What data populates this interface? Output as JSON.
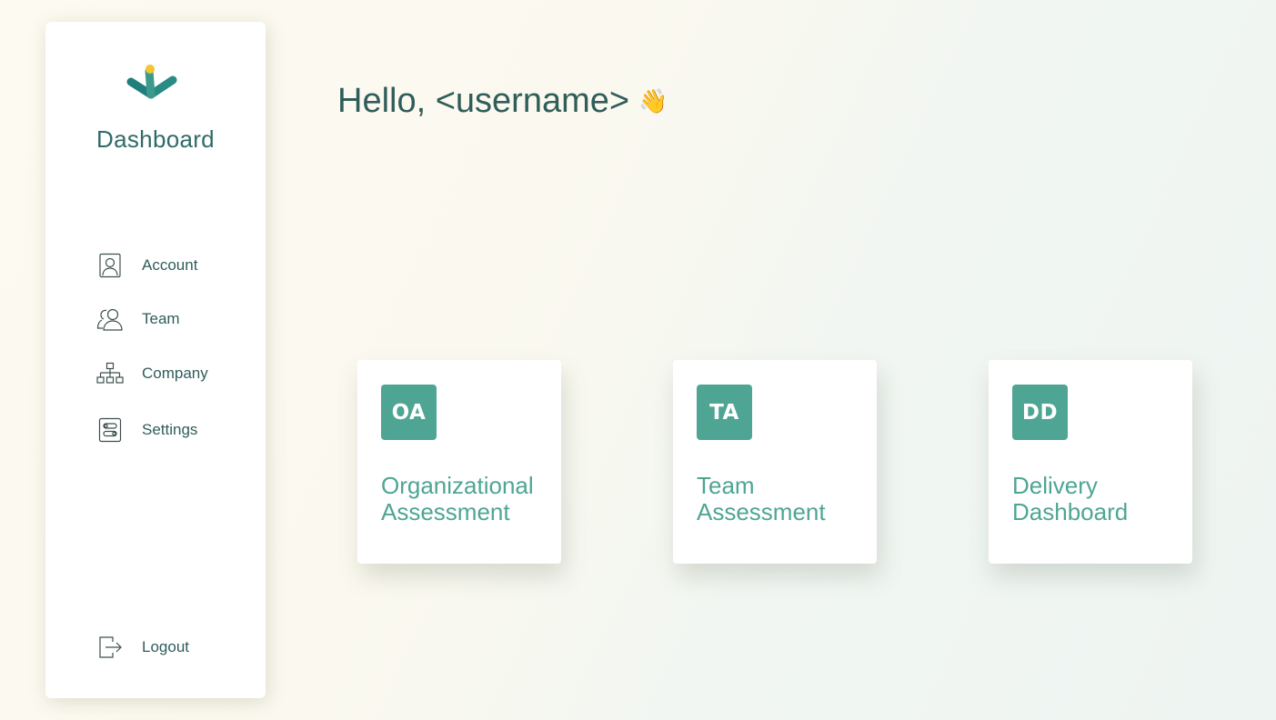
{
  "sidebar": {
    "brand_title": "Dashboard",
    "nav": [
      {
        "label": "Account",
        "icon": "account-icon"
      },
      {
        "label": "Team",
        "icon": "team-icon"
      },
      {
        "label": "Company",
        "icon": "org-chart-icon"
      },
      {
        "label": "Settings",
        "icon": "settings-icon"
      }
    ],
    "logout_label": "Logout"
  },
  "main": {
    "greeting": "Hello, <username>",
    "greeting_emoji": "👋",
    "cards": [
      {
        "badge": "OA",
        "title_line1": "Organizational",
        "title_line2": "Assessment"
      },
      {
        "badge": "TA",
        "title_line1": "Team",
        "title_line2": "Assessment"
      },
      {
        "badge": "DD",
        "title_line1": "Delivery",
        "title_line2": "Dashboard"
      }
    ]
  },
  "colors": {
    "accent": "#4fa593",
    "text": "#2f5d5a",
    "logo_teal": "#1f7f7a",
    "logo_yellow": "#f2c531"
  }
}
